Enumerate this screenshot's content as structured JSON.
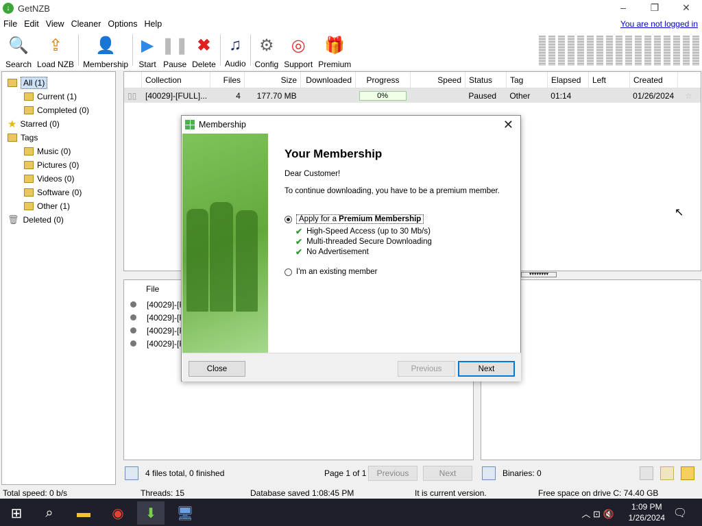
{
  "window": {
    "title": "GetNZB"
  },
  "menu": [
    "File",
    "Edit",
    "View",
    "Cleaner",
    "Options",
    "Help"
  ],
  "login_link": "You are not logged in",
  "toolbar": [
    {
      "label": "Search",
      "icon": "search-icon"
    },
    {
      "label": "Load NZB",
      "icon": "upload-icon"
    },
    {
      "label": "Membership",
      "icon": "user-icon"
    },
    {
      "label": "Start",
      "icon": "play-icon"
    },
    {
      "label": "Pause",
      "icon": "pause-icon"
    },
    {
      "label": "Delete",
      "icon": "delete-icon"
    },
    {
      "label": "Audio",
      "icon": "music-icon"
    },
    {
      "label": "Config",
      "icon": "gear-icon"
    },
    {
      "label": "Support",
      "icon": "lifebuoy-icon"
    },
    {
      "label": "Premium",
      "icon": "gift-icon"
    }
  ],
  "tree": {
    "all": "All (1)",
    "current": "Current (1)",
    "completed": "Completed (0)",
    "starred": "Starred (0)",
    "tags": "Tags",
    "music": "Music (0)",
    "pictures": "Pictures (0)",
    "videos": "Videos (0)",
    "software": "Software (0)",
    "other": "Other (1)",
    "deleted": "Deleted (0)"
  },
  "grid": {
    "headers": {
      "collection": "Collection",
      "files": "Files",
      "size": "Size",
      "downloaded": "Downloaded",
      "progress": "Progress",
      "speed": "Speed",
      "status": "Status",
      "tag": "Tag",
      "elapsed": "Elapsed",
      "left": "Left",
      "created": "Created"
    },
    "row": {
      "collection": "[40029]-[FULL]...",
      "files": "4",
      "size": "177.70 MB",
      "downloaded": "",
      "progress": "0%",
      "speed": "",
      "status": "Paused",
      "tag": "Other",
      "elapsed": "01:14",
      "left": "",
      "created": "01/26/2024"
    }
  },
  "files_pane": {
    "header": "File",
    "rows": [
      "[40029]-[F",
      "[40029]-[F",
      "[40029]-[F",
      "[40029]-[F"
    ]
  },
  "pager": {
    "summary": "4 files total, 0 finished",
    "page": "Page 1 of 1",
    "previous": "Previous",
    "next": "Next",
    "binaries": "Binaries: 0"
  },
  "status": {
    "speed": "Total speed: 0 b/s",
    "threads": "Threads: 15",
    "db": "Database saved 1:08:45 PM",
    "version": "It is current version.",
    "space": "Free space on drive C: 74.40 GB"
  },
  "taskbar": {
    "time": "1:09 PM",
    "date": "1/26/2024"
  },
  "dialog": {
    "title": "Membership",
    "heading": "Your Membership",
    "greeting": "Dear Customer!",
    "message": "To continue downloading, you have to be a premium member.",
    "option1_prefix": "Apply for a ",
    "option1_bold": "Premium Membership",
    "features": [
      "High-Speed Access (up to 30 Mb/s)",
      "Multi-threaded Secure Downloading",
      "No Advertisement"
    ],
    "option2": "I'm an existing member",
    "close": "Close",
    "previous": "Previous",
    "next": "Next"
  }
}
